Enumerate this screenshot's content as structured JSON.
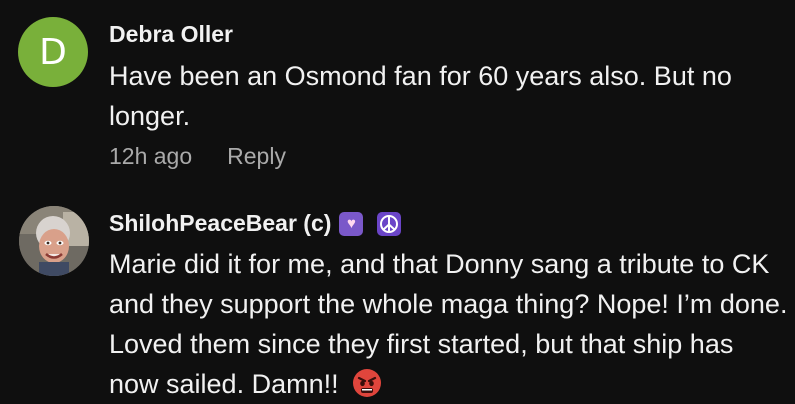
{
  "comments": [
    {
      "avatar_letter": "D",
      "author": "Debra Oller",
      "text": "Have been an Osmond fan for 60 years also. But no longer.",
      "timestamp": "12h ago",
      "reply_label": "Reply",
      "avatar_color": "#79b03a"
    },
    {
      "author": "ShilohPeaceBear (c)",
      "badges": [
        "heart-badge-icon",
        "peace-badge-icon"
      ],
      "text": "Marie did it for me, and that Donny sang a tribute to CK and they support the whole maga thing? Nope! I’m done. Loved them since they first started, but that ship has now sailed. Damn!!",
      "emoji": "angry-face-icon"
    }
  ],
  "colors": {
    "background": "#0f0f0f",
    "text_primary": "#f1f1f1",
    "text_secondary": "#aaaaaa",
    "badge_purple": "#6b45c8"
  }
}
